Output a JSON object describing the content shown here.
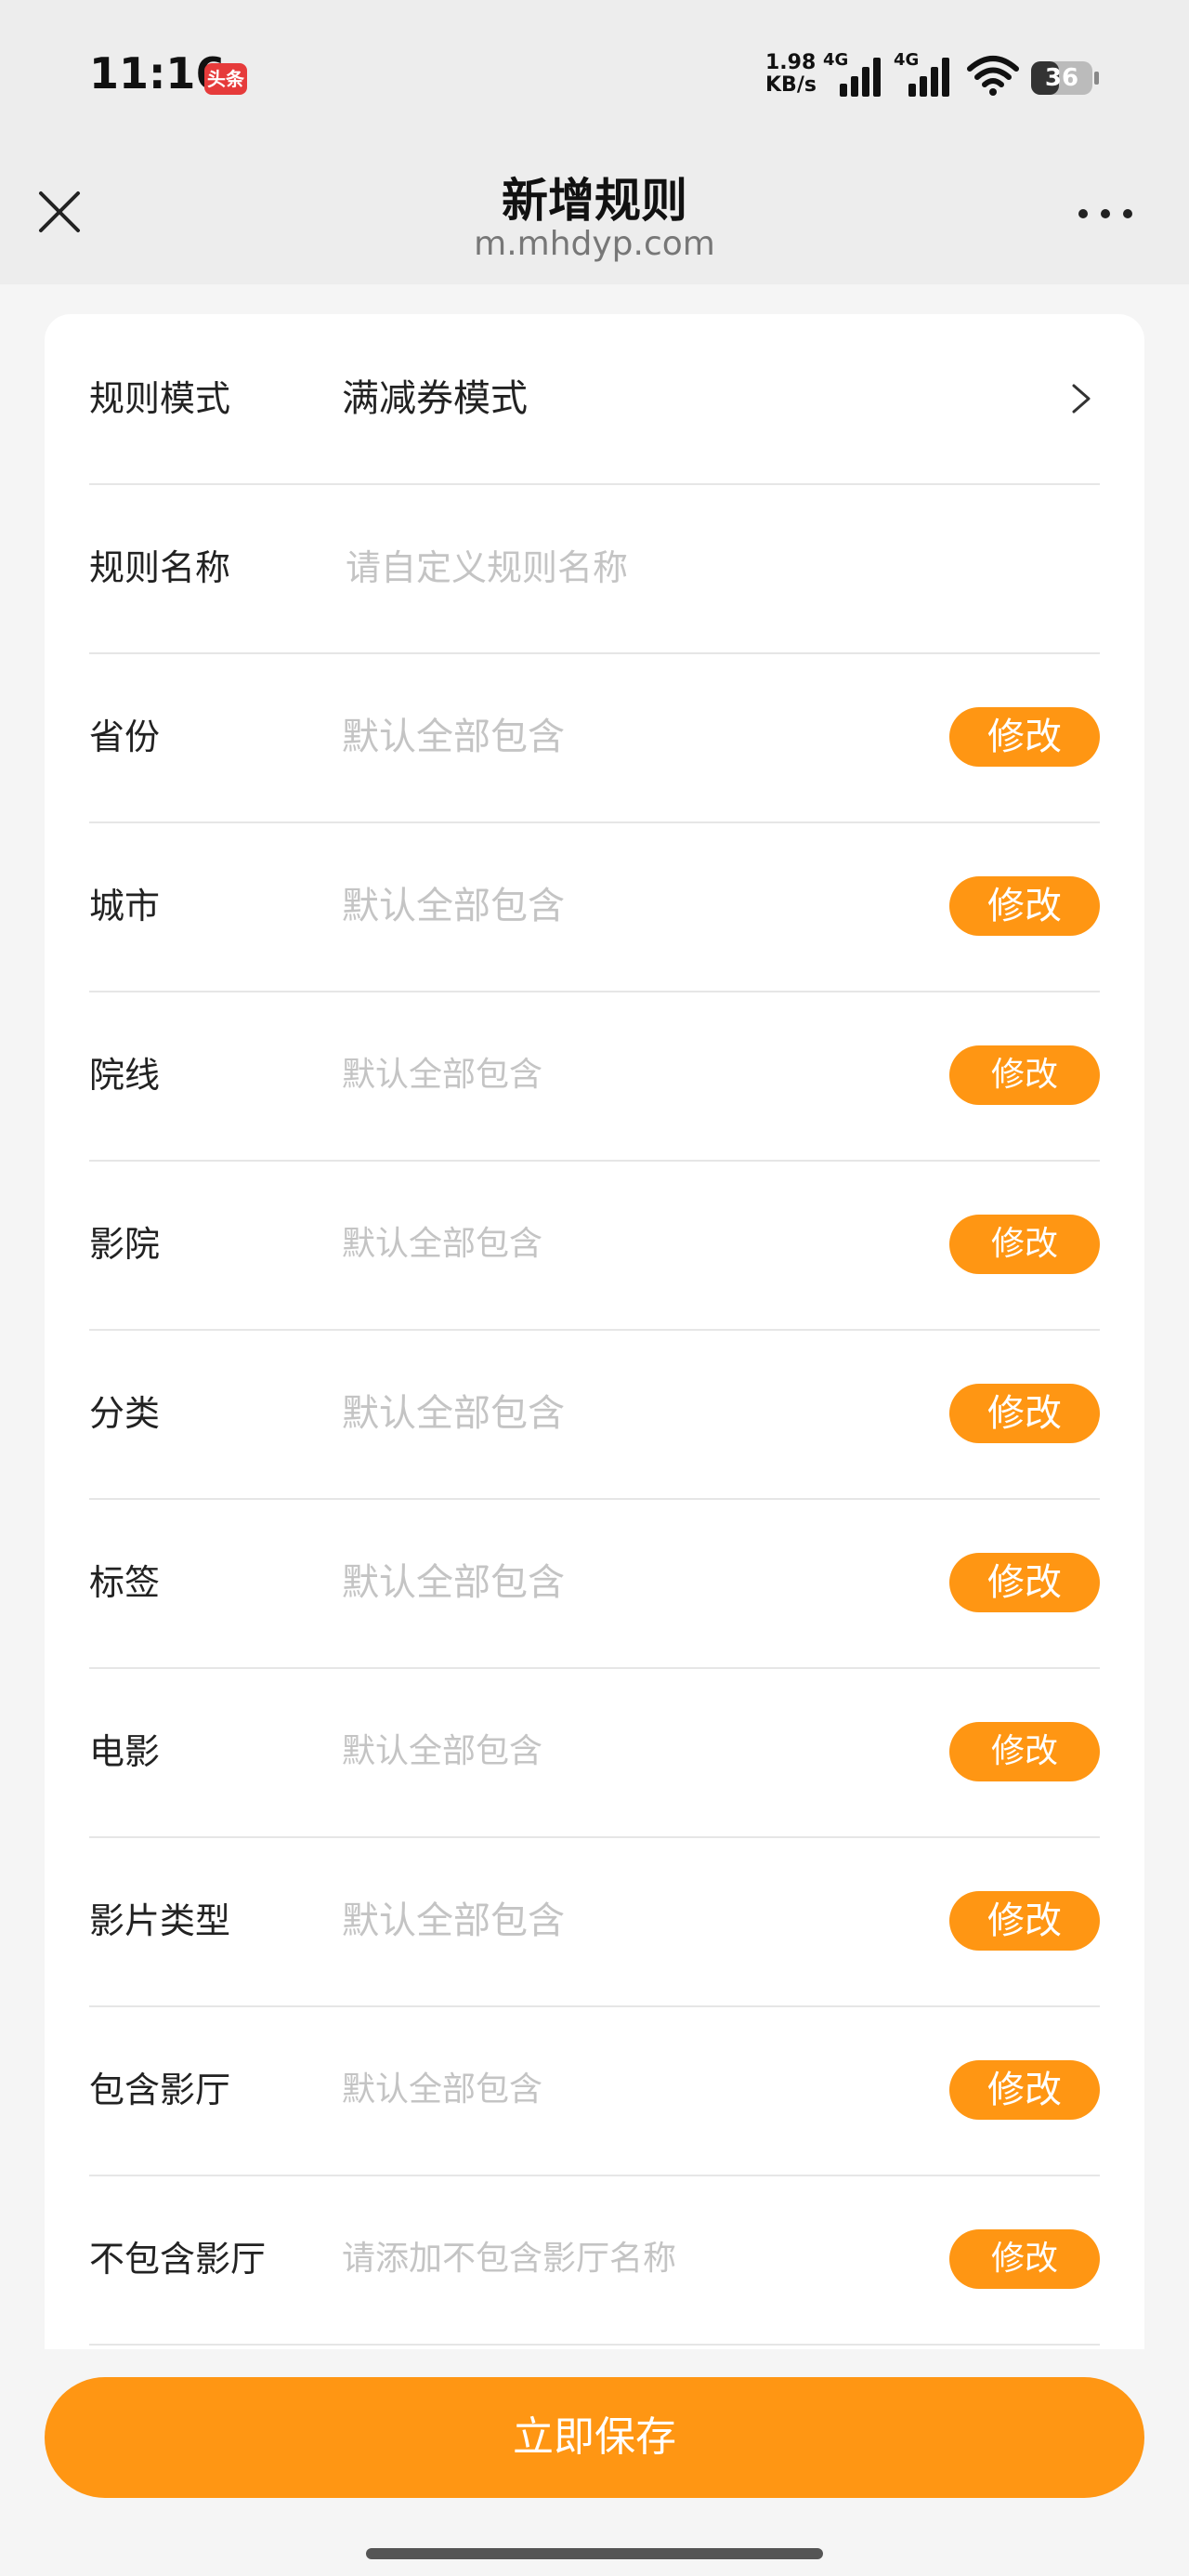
{
  "status": {
    "time": "11:16",
    "app_badge": "头条",
    "net_speed_value": "1.98",
    "net_speed_unit": "KB/s",
    "sim1_type": "4G",
    "sim2_type": "4G",
    "battery": "36"
  },
  "nav": {
    "title": "新增规则",
    "url": "m.mhdyp.com"
  },
  "form": {
    "mode": {
      "label": "规则模式",
      "value": "满减券模式"
    },
    "name": {
      "label": "规则名称",
      "placeholder": "请自定义规则名称"
    },
    "rows": [
      {
        "label": "省份",
        "placeholder": "默认全部包含",
        "button": "修改"
      },
      {
        "label": "城市",
        "placeholder": "默认全部包含",
        "button": "修改"
      },
      {
        "label": "院线",
        "placeholder": "默认全部包含",
        "button": "修改"
      },
      {
        "label": "影院",
        "placeholder": "默认全部包含",
        "button": "修改"
      },
      {
        "label": "分类",
        "placeholder": "默认全部包含",
        "button": "修改"
      },
      {
        "label": "标签",
        "placeholder": "默认全部包含",
        "button": "修改"
      },
      {
        "label": "电影",
        "placeholder": "默认全部包含",
        "button": "修改"
      },
      {
        "label": "影片类型",
        "placeholder": "默认全部包含",
        "button": "修改"
      },
      {
        "label": "包含影厅",
        "placeholder": "默认全部包含",
        "button": "修改"
      },
      {
        "label": "不包含影厅",
        "placeholder": "请添加不包含影厅名称",
        "button": "修改"
      }
    ]
  },
  "save_button": "立即保存",
  "colors": {
    "accent": "#ff9613",
    "placeholder": "#c4c4c4",
    "background": "#f5f5f5"
  }
}
